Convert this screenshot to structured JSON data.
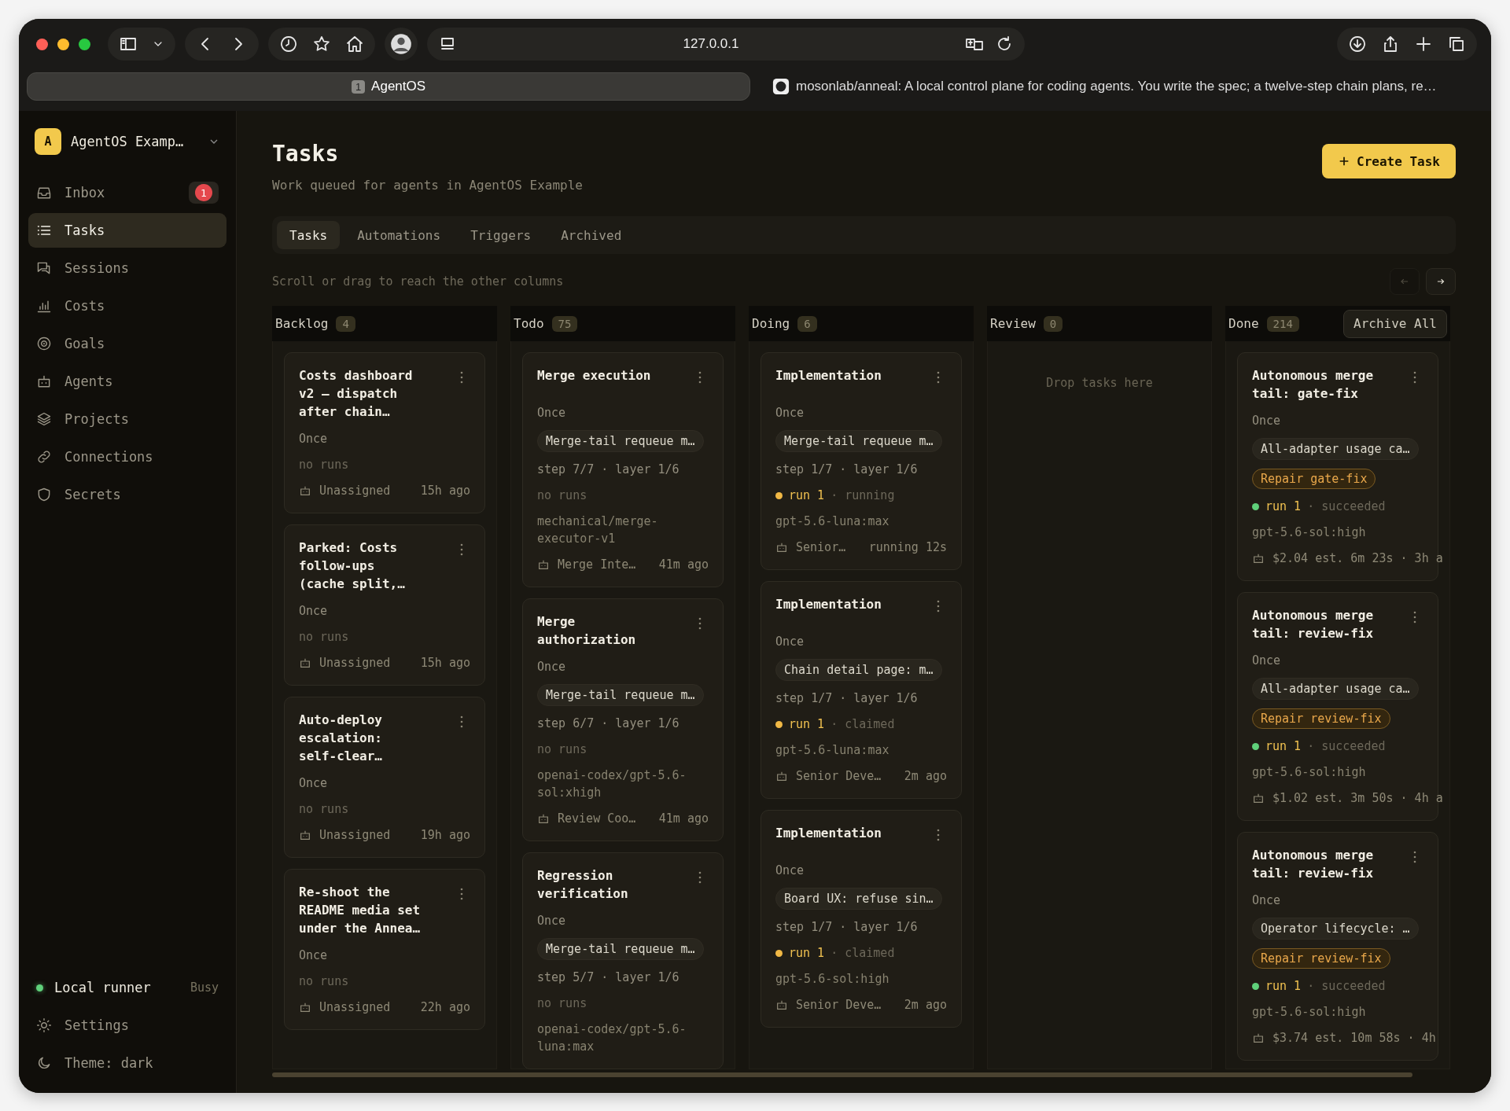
{
  "browser": {
    "url": "127.0.0.1",
    "tabs": [
      {
        "number": "1",
        "label": "AgentOS",
        "selected": true
      },
      {
        "label": "mosonlab/anneal: A local control plane for coding agents. You write the spec; a twelve-step chain plans, re…",
        "selected": false
      }
    ]
  },
  "workspace": {
    "initial": "A",
    "name": "AgentOS Examp…"
  },
  "sidebar": {
    "items": [
      {
        "label": "Inbox",
        "badge": "1",
        "selected": false
      },
      {
        "label": "Tasks",
        "selected": true
      },
      {
        "label": "Sessions",
        "selected": false
      },
      {
        "label": "Costs",
        "selected": false
      },
      {
        "label": "Goals",
        "selected": false
      },
      {
        "label": "Agents",
        "selected": false
      },
      {
        "label": "Projects",
        "selected": false
      },
      {
        "label": "Connections",
        "selected": false
      },
      {
        "label": "Secrets",
        "selected": false
      }
    ],
    "runner": {
      "label": "Local runner",
      "status": "Busy",
      "color": "#5fd07a"
    },
    "bottom_items": [
      {
        "label": "Settings"
      },
      {
        "label": "Theme: dark"
      }
    ]
  },
  "page": {
    "title": "Tasks",
    "subtitle": "Work queued for agents in AgentOS Example",
    "create_button": "Create Task",
    "tabs": [
      {
        "label": "Tasks",
        "selected": true
      },
      {
        "label": "Automations",
        "selected": false
      },
      {
        "label": "Triggers",
        "selected": false
      },
      {
        "label": "Archived",
        "selected": false
      }
    ],
    "hint": "Scroll or drag to reach the other columns",
    "scroll_buttons": [
      {
        "disabled": true
      },
      {
        "disabled": false
      }
    ]
  },
  "columns": [
    {
      "name": "Backlog",
      "count": "4",
      "cards": [
        {
          "title": "Costs dashboard v2 – dispatch after chain…",
          "schedule": "Once",
          "runs": "no runs",
          "assignee": "Unassigned",
          "time": "15h ago"
        },
        {
          "title": "Parked: Costs follow-ups (cache split,…",
          "schedule": "Once",
          "runs": "no runs",
          "assignee": "Unassigned",
          "time": "15h ago"
        },
        {
          "title": "Auto-deploy escalation: self-clear…",
          "schedule": "Once",
          "runs": "no runs",
          "assignee": "Unassigned",
          "time": "19h ago"
        },
        {
          "title": "Re-shoot the README media set under the Annea…",
          "schedule": "Once",
          "runs": "no runs",
          "assignee": "Unassigned",
          "time": "22h ago"
        }
      ]
    },
    {
      "name": "Todo",
      "count": "75",
      "cards": [
        {
          "title": "Merge execution",
          "schedule": "Once",
          "chain": "Merge-tail requeue m…",
          "step": "step 7/7 · layer 1/6",
          "runs": "no runs",
          "model": "mechanical/merge-executor-v1",
          "assignee": "Merge Inte…",
          "time": "41m ago"
        },
        {
          "title": "Merge authorization",
          "schedule": "Once",
          "chain": "Merge-tail requeue m…",
          "step": "step 6/7 · layer 1/6",
          "runs": "no runs",
          "model": "openai-codex/gpt-5.6-sol:xhigh",
          "assignee": "Review Coo…",
          "time": "41m ago"
        },
        {
          "title": "Regression verification",
          "schedule": "Once",
          "chain": "Merge-tail requeue m…",
          "step": "step 5/7 · layer 1/6",
          "runs": "no runs",
          "model": "openai-codex/gpt-5.6-luna:max"
        }
      ]
    },
    {
      "name": "Doing",
      "count": "6",
      "cards": [
        {
          "title": "Implementation",
          "schedule": "Once",
          "chain": "Merge-tail requeue m…",
          "step": "step 1/7 · layer 1/6",
          "run": {
            "label": "run 1",
            "status": "· running",
            "color": "#f0b845"
          },
          "model": "gpt-5.6-luna:max",
          "assignee": "Senior…",
          "time": "running 12s"
        },
        {
          "title": "Implementation",
          "schedule": "Once",
          "chain": "Chain detail page: m…",
          "step": "step 1/7 · layer 1/6",
          "run": {
            "label": "run 1",
            "status": "· claimed",
            "color": "#f0b845"
          },
          "model": "gpt-5.6-luna:max",
          "assignee": "Senior Deve…",
          "time": "2m ago"
        },
        {
          "title": "Implementation",
          "schedule": "Once",
          "chain": "Board UX: refuse sin…",
          "step": "step 1/7 · layer 1/6",
          "run": {
            "label": "run 1",
            "status": "· claimed",
            "color": "#f0b845"
          },
          "model": "gpt-5.6-sol:high",
          "assignee": "Senior Deve…",
          "time": "2m ago"
        }
      ]
    },
    {
      "name": "Review",
      "count": "0",
      "empty": "Drop tasks here"
    },
    {
      "name": "Done",
      "count": "214",
      "action": "Archive All",
      "cards": [
        {
          "title": "Autonomous merge tail: gate-fix",
          "schedule": "Once",
          "chain": "All-adapter usage ca…",
          "tag": "Repair gate-fix",
          "run": {
            "label": "run 1",
            "status": "· succeeded",
            "color": "#5fd07a"
          },
          "model": "gpt-5.6-sol:high",
          "time": "$2.04 est.  6m 23s · 3h a"
        },
        {
          "title": "Autonomous merge tail: review-fix",
          "schedule": "Once",
          "chain": "All-adapter usage ca…",
          "tag": "Repair review-fix",
          "run": {
            "label": "run 1",
            "status": "· succeeded",
            "color": "#5fd07a"
          },
          "model": "gpt-5.6-sol:high",
          "time": "$1.02 est.  3m 50s · 4h a"
        },
        {
          "title": "Autonomous merge tail: review-fix",
          "schedule": "Once",
          "chain": "Operator lifecycle: …",
          "tag": "Repair review-fix",
          "run": {
            "label": "run 1",
            "status": "· succeeded",
            "color": "#5fd07a"
          },
          "model": "gpt-5.6-sol:high",
          "time": "$3.74 est.  10m 58s · 4h"
        }
      ]
    }
  ]
}
